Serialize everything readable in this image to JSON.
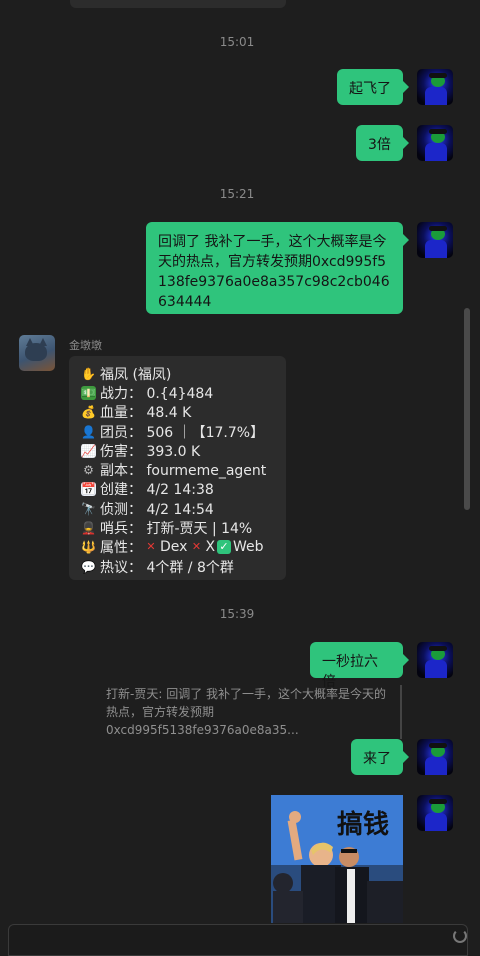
{
  "chat": {
    "timestamps": [
      "15:01",
      "15:21",
      "15:39"
    ],
    "messages": {
      "m1": "起飞了",
      "m2": "3倍",
      "m3": "回调了  我补了一手，这个大概率是今天的热点，官方转发预期0xcd995f5138fe9376a0e8a357c98c2cb046634444",
      "m4": "一秒拉六倍",
      "m5": "来了"
    },
    "bot": {
      "sender": "金墩墩",
      "lines": [
        {
          "icon": "hand-icon",
          "emoji": "✋",
          "text": "福凤 (福凤)"
        },
        {
          "icon": "money-icon",
          "emoji": "💵",
          "text": "战力： 0.{4}484"
        },
        {
          "icon": "money-bag-icon",
          "emoji": "💰",
          "text": "血量： 48.4 K"
        },
        {
          "icon": "person-icon",
          "emoji": "👤",
          "text": "团员： 506 ｜【17.7%】"
        },
        {
          "icon": "chart-icon",
          "emoji": "📈",
          "text": "伤害： 393.0 K"
        },
        {
          "icon": "gear-icon",
          "emoji": "⚙",
          "text": "副本： fourmeme_agent"
        },
        {
          "icon": "calendar-icon",
          "emoji": "📅",
          "text": "创建： 4/2 14:38"
        },
        {
          "icon": "probe-icon",
          "emoji": "🔭",
          "text": "侦测： 4/2 14:54"
        },
        {
          "icon": "guard-icon",
          "emoji": "💂",
          "text": "哨兵： 打新-贾天 | 14%"
        },
        {
          "icon": "trident-icon",
          "emoji": "🔱",
          "text": "属性："
        },
        {
          "icon": "speech-icon",
          "emoji": "💬",
          "text": "热议： 4个群 / 8个群"
        }
      ],
      "attr": {
        "dex": "Dex",
        "x": "X",
        "web": "Web"
      }
    },
    "quote": "打新-贾天: 回调了  我补了一手，这个大概率是今天的热点，官方转发预期0xcd995f5138fe9376a0e8a35...",
    "image_text": "搞钱"
  },
  "colors": {
    "bubble": "#2fc47c",
    "card": "#2c2c2c",
    "bg": "#1e1e1e"
  }
}
